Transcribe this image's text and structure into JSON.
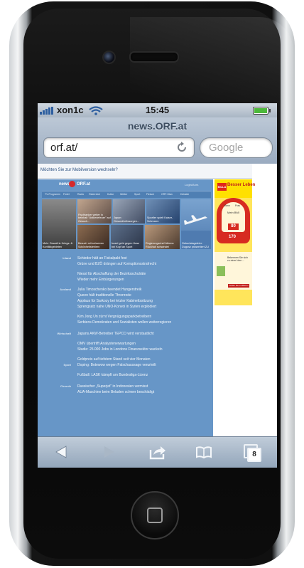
{
  "status_bar": {
    "carrier": "xon1c",
    "time": "15:45"
  },
  "browser": {
    "page_title": "news.ORF.at",
    "url": "orf.at/",
    "search_placeholder": "Google",
    "tab_count": "8"
  },
  "page": {
    "mobile_banner": "Möchten Sie zur Mobilversion wechseln?",
    "header_news": "news",
    "header_orf": "ORF.at",
    "login": "Login/Anm.",
    "nav": [
      "TV-Programm",
      "Fmtel",
      "Radio",
      "Österreich",
      "Kultur",
      "Wetter",
      "Sport",
      "Fleisch",
      "ORF-Stan",
      "Debatte"
    ],
    "teaser_captions": [
      "Mehr Gewalt in Kriegs- & Konfliktgebieten",
      "Fischtanker weiter in beinhalt \"Artilleriefeuer\" auf Gesuch...",
      "Japan: Gesundheitssorgen...",
      "Sportler spielt Kaiser-Schmarrn",
      "\"Al Kaida-Terrorist\" war CIA-Informant",
      "Besuch mit schweren Schönheitsfehlern",
      "Israel geht gegen Hass bei Kopf an Sport",
      "Regierungschef Athens: Rückhalt schwindet",
      "Geburtstagsfeier: Dugosz präsentiert ZU"
    ],
    "headlines": [
      {
        "category": "Inland",
        "items": [
          "Schieder hält an Fiskalpakt fest",
          "Grüne und BZÖ drängen auf Korruptionsstrafrecht",
          "Niessl für Abschaffung der Bezirksschulräte",
          "Wieder mehr Einbürgerungen"
        ]
      },
      {
        "category": "Ausland",
        "items": [
          "Julia Timoschenko beendet Hungerstreik",
          "Queen hält traditionelle Thronrede",
          "Applaus für Sarkozy bei letzter Kabinettssitzung",
          "Sprengsatz nahe UNO-Konvoi in Syrien explodiert",
          "Kim Jong Un zürnt Vergnügungsparkbetreibern",
          "Serbiens Demokraten und Sozialisten wollen weiterregieren"
        ]
      },
      {
        "category": "Wirtschaft",
        "items": [
          "Japans AKW-Betreiber TEPCO wird verstaatlicht",
          "OMV übertrifft Analystenerwartungen",
          "Studie: 25.000 Jobs in Londons Finanzsektor wackeln",
          "Goldpreis auf tiefstem Stand seit vier Monaten"
        ]
      },
      {
        "category": "Sport",
        "items": [
          "Doping: Botewow wegen Falschaussage verurteilt",
          "Fußball: LASK kämpft um Bundesliga-Lizenz"
        ]
      },
      {
        "category": "Chronik",
        "items": [
          "Russischer „Superjet“ in Indonesien vermisst",
          "AUA-Maschine beim Beladen schwer beschädigt"
        ]
      }
    ],
    "ad": {
      "logo": "BILLA",
      "slogan": "Besser Leben",
      "tabs": [
        "Mann",
        "Frau"
      ],
      "caption": "Mein BMI",
      "value1": "80",
      "value2": "170",
      "button": "Jetzt BMI berechnen!",
      "text2": "Bekennen Sie sich zu einer Idee ...",
      "button2": "Fehlen Sie mit BILLA!"
    }
  },
  "colors": {
    "orf_blue": "#6796c7",
    "billa_red": "#d72b20",
    "billa_yellow": "#ffe000"
  }
}
